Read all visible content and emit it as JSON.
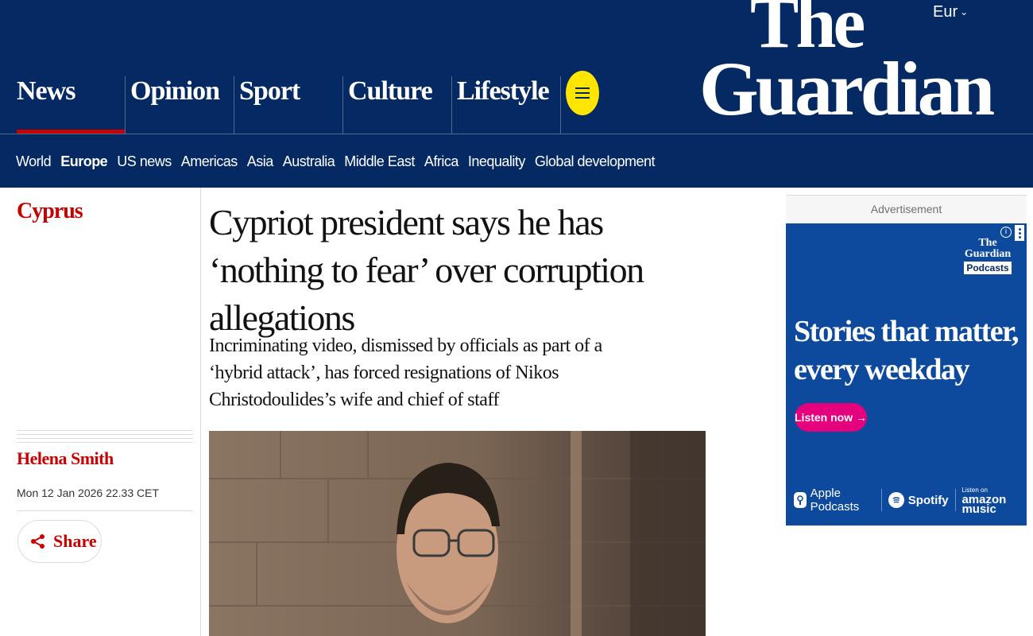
{
  "edition": {
    "label": "Eur"
  },
  "logo": {
    "line1": "The",
    "line2": "Guardian"
  },
  "pillars": [
    {
      "label": "News",
      "active": true
    },
    {
      "label": "Opinion",
      "active": false
    },
    {
      "label": "Sport",
      "active": false
    },
    {
      "label": "Culture",
      "active": false
    },
    {
      "label": "Lifestyle",
      "active": false
    }
  ],
  "subnav": [
    {
      "label": "World",
      "current": false
    },
    {
      "label": "Europe",
      "current": true
    },
    {
      "label": "US news",
      "current": false
    },
    {
      "label": "Americas",
      "current": false
    },
    {
      "label": "Asia",
      "current": false
    },
    {
      "label": "Australia",
      "current": false
    },
    {
      "label": "Middle East",
      "current": false
    },
    {
      "label": "Africa",
      "current": false
    },
    {
      "label": "Inequality",
      "current": false
    },
    {
      "label": "Global development",
      "current": false
    }
  ],
  "article": {
    "section": "Cyprus",
    "headline": "Cypriot president says he has ‘nothing to fear’ over corruption allegations",
    "standfirst": "Incriminating video, dismissed by officials as part of a ‘hybrid attack’, has forced resignations of Nikos Christodoulides’s wife and chief of staff",
    "byline": "Helena Smith",
    "dateline": "Mon 12 Jan 2026 22.33 CET",
    "share_label": "Share"
  },
  "ad": {
    "label": "Advertisement",
    "brand_line1": "The",
    "brand_line2": "Guardian",
    "brand_line3": "Podcasts",
    "headline": "Stories that matter, every weekday",
    "cta": "Listen now →",
    "platforms": {
      "apple": "Apple Podcasts",
      "spotify": "Spotify",
      "amazon_small": "Listen on",
      "amazon_big": "amazon music"
    }
  },
  "colors": {
    "brand": "#052962",
    "news_accent": "#c70000",
    "menu_button": "#ffe500",
    "ad_background": "#0d4a9e",
    "ad_cta": "#e5007e"
  },
  "icons": [
    "chevron-down-icon",
    "menu-icon",
    "share-icon",
    "info-icon",
    "more-options-icon",
    "apple-podcasts-icon",
    "spotify-icon"
  ]
}
